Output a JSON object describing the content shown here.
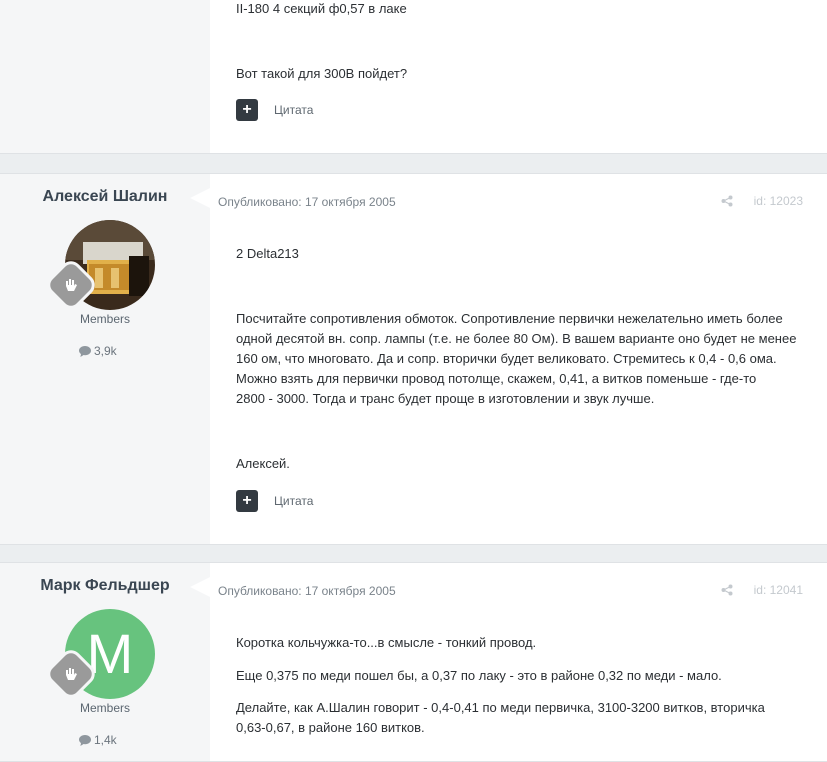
{
  "posts": [
    {
      "lines": [
        "II-180 4 секций ф0,57 в лаке",
        "Вот такой для 300В пойдет?"
      ],
      "quote_label": "Цитата"
    },
    {
      "author": "Алексей Шалин",
      "group": "Members",
      "post_count": "3,9k",
      "published": "Опубликовано: 17 октября 2005",
      "post_id": "id: 12023",
      "lines": [
        "2 Delta213",
        "Посчитайте сопротивления обмоток. Сопротивление первички нежелательно иметь более",
        "одной десятой вн. сопр. лампы (т.е. не более 80 Ом). В вашем варианте оно будет не менее",
        "160 ом, что многовато. Да и сопр. вторички будет великовато. Стремитесь к 0,4 - 0,6 ома.",
        "Можно взять для первички провод потолще, скажем, 0,41, а витков поменьше - где-то",
        "2800 - 3000. Тогда и транс будет проще в изготовлении и звук лучше.",
        "Алексей."
      ],
      "quote_label": "Цитата"
    },
    {
      "author": "Марк Фельдшер",
      "avatar_letter": "M",
      "group": "Members",
      "post_count": "1,4k",
      "published": "Опубликовано: 17 октября 2005",
      "post_id": "id: 12041",
      "lines": [
        "Коротка кольчужка-то...в смысле - тонкий провод.",
        "Еще 0,375 по меди пошел бы, а 0,37 по лаку - это в районе 0,32 по меди - мало.",
        "Делайте, как А.Шалин говорит - 0,4-0,41 по меди первичка, 3100-3200 витков, вторичка",
        "0,63-0,67, в районе 160 витков."
      ]
    }
  ],
  "colors": {
    "accent_green": "#67c37e",
    "page_bg": "#ebeef0"
  },
  "icons": [
    "plus-icon",
    "comment-icon",
    "share-icon",
    "rank-hand-icon"
  ]
}
